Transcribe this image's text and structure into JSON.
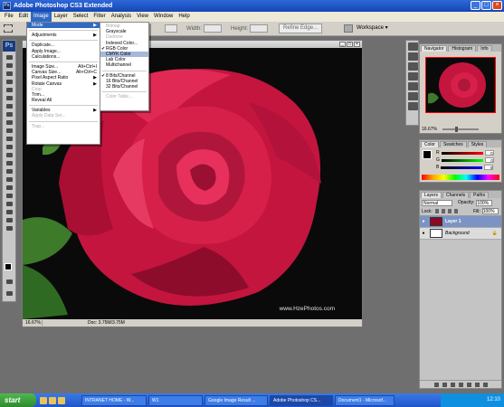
{
  "window": {
    "title": "Adobe Photoshop CS3 Extended"
  },
  "menubar": [
    "File",
    "Edit",
    "Image",
    "Layer",
    "Select",
    "Filter",
    "Analysis",
    "View",
    "Window",
    "Help"
  ],
  "options": {
    "width_label": "Width:",
    "height_label": "Height:",
    "refine_edge": "Refine Edge...",
    "workspace": "Workspace ▾"
  },
  "image_menu": {
    "items": [
      {
        "label": "Mode",
        "arrow": "▶",
        "state": "highlighted"
      },
      {
        "sep": true
      },
      {
        "label": "Adjustments",
        "arrow": "▶"
      },
      {
        "sep": true
      },
      {
        "label": "Duplicate..."
      },
      {
        "label": "Apply Image..."
      },
      {
        "label": "Calculations..."
      },
      {
        "sep": true
      },
      {
        "label": "Image Size...",
        "shortcut": "Alt+Ctrl+I"
      },
      {
        "label": "Canvas Size...",
        "shortcut": "Alt+Ctrl+C"
      },
      {
        "label": "Pixel Aspect Ratio",
        "arrow": "▶"
      },
      {
        "label": "Rotate Canvas",
        "arrow": "▶"
      },
      {
        "label": "Crop",
        "state": "disabled"
      },
      {
        "label": "Trim..."
      },
      {
        "label": "Reveal All"
      },
      {
        "sep": true
      },
      {
        "label": "Variables",
        "arrow": "▶"
      },
      {
        "label": "Apply Data Set...",
        "state": "disabled"
      },
      {
        "sep": true
      },
      {
        "label": "Trap...",
        "state": "disabled"
      }
    ]
  },
  "mode_menu": {
    "items": [
      {
        "label": "Bitmap",
        "state": "disabled"
      },
      {
        "label": "Grayscale"
      },
      {
        "label": "Duotone",
        "state": "disabled"
      },
      {
        "label": "Indexed Color..."
      },
      {
        "label": "RGB Color",
        "check": "✔"
      },
      {
        "label": "CMYK Color",
        "state": "highlighted"
      },
      {
        "label": "Lab Color"
      },
      {
        "label": "Multichannel"
      },
      {
        "sep": true
      },
      {
        "label": "8 Bits/Channel",
        "check": "✔"
      },
      {
        "label": "16 Bits/Channel"
      },
      {
        "label": "32 Bits/Channel"
      },
      {
        "sep": true
      },
      {
        "label": "Color Table...",
        "state": "disabled"
      }
    ]
  },
  "document": {
    "zoom": "16.67%",
    "doc_info": "Doc: 3.75M/3.75M",
    "watermark": "www.HzePhotos.com"
  },
  "navigator": {
    "tabs": [
      "Navigator",
      "Histogram",
      "Info"
    ],
    "zoom": "16.67%"
  },
  "color_panel": {
    "tabs": [
      "Color",
      "Swatches",
      "Styles"
    ],
    "rows": [
      {
        "ch": "R",
        "val": "0"
      },
      {
        "ch": "G",
        "val": "0"
      },
      {
        "ch": "B",
        "val": "0"
      }
    ]
  },
  "layers_panel": {
    "tabs": [
      "Layers",
      "Channels",
      "Paths"
    ],
    "blend_mode": "Normal",
    "opacity_label": "Opacity:",
    "opacity": "100%",
    "lock_label": "Lock:",
    "fill_label": "Fill:",
    "fill": "100%",
    "layers": [
      {
        "name": "Layer 1",
        "selected": true
      },
      {
        "name": "Background",
        "selected": false
      }
    ]
  },
  "taskbar": {
    "start": "start",
    "tasks": [
      "INTRANET HOME - W...",
      "W1",
      "Google Image Result ...",
      "Adobe Photoshop CS...",
      "Document1 - Microsof..."
    ],
    "active_task": 3,
    "clock": "12:10"
  },
  "colors": {
    "rose": "#d4204c",
    "rose_dark": "#8a0a25",
    "leaf": "#3a7a2a"
  }
}
